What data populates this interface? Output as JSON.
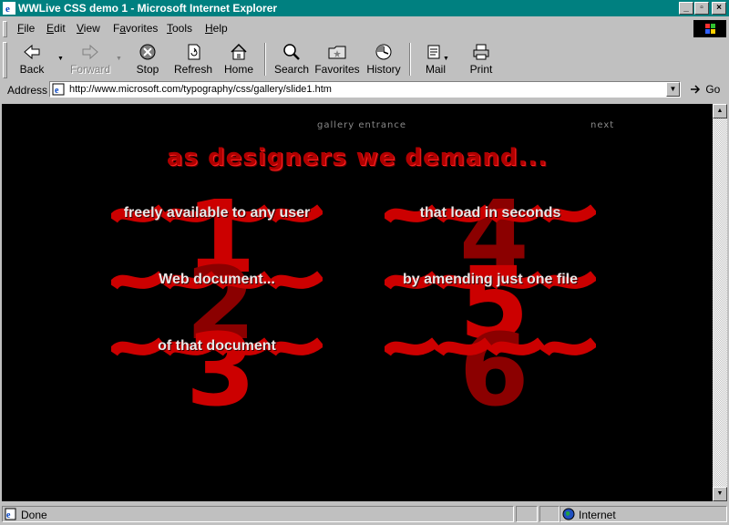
{
  "window": {
    "title": "WWLive CSS demo 1 - Microsoft Internet Explorer",
    "controls": [
      "_",
      "▫",
      "×"
    ]
  },
  "menu": [
    {
      "label": "File",
      "accel": "F",
      "rest": "ile"
    },
    {
      "label": "Edit",
      "accel": "E",
      "rest": "dit"
    },
    {
      "label": "View",
      "accel": "V",
      "rest": "iew"
    },
    {
      "label": "Favorites",
      "accel": "a",
      "pre": "F",
      "rest": "vorites"
    },
    {
      "label": "Tools",
      "accel": "T",
      "rest": "ools"
    },
    {
      "label": "Help",
      "accel": "H",
      "rest": "elp"
    }
  ],
  "toolbar": {
    "back": "Back",
    "forward": "Forward",
    "stop": "Stop",
    "refresh": "Refresh",
    "home": "Home",
    "search": "Search",
    "favorites": "Favorites",
    "history": "History",
    "mail": "Mail",
    "print": "Print"
  },
  "address": {
    "label": "Address",
    "url": "http://www.microsoft.com/typography/css/gallery/slide1.htm",
    "go": "Go"
  },
  "page": {
    "nav_left": "gallery entrance",
    "nav_right": "next",
    "headline": "as designers we demand...",
    "colors": {
      "background": "#000000",
      "accent": "#cc0000",
      "accent_dark": "#8b0000",
      "text": "#e8e8e8"
    },
    "items": [
      {
        "number": "1",
        "text": "freely available to any user"
      },
      {
        "number": "2",
        "text": "Web document..."
      },
      {
        "number": "3",
        "text": "of that document"
      },
      {
        "number": "4",
        "text": "that load in seconds"
      },
      {
        "number": "5",
        "text": "by amending just one file"
      },
      {
        "number": "6",
        "text": ""
      }
    ]
  },
  "status": {
    "text": "Done",
    "zone": "Internet"
  }
}
